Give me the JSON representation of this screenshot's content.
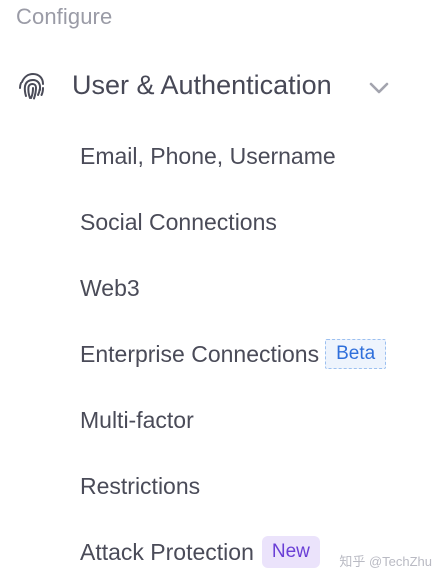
{
  "sidebar": {
    "section_title": "Configure",
    "group": {
      "label": "User & Authentication",
      "icon": "fingerprint-icon",
      "toggle_icon": "chevron-down-icon",
      "expanded": true
    },
    "items": [
      {
        "label": "Email, Phone, Username"
      },
      {
        "label": "Social Connections"
      },
      {
        "label": "Web3"
      },
      {
        "label": "Enterprise Connections",
        "badge": "Beta"
      },
      {
        "label": "Multi-factor"
      },
      {
        "label": "Restrictions"
      },
      {
        "label": "Attack Protection",
        "badge": "New"
      }
    ]
  },
  "watermark": "知乎 @TechZhu",
  "colors": {
    "section_title": "#9a9ba6",
    "text": "#4a4b58",
    "beta_badge_text": "#2f6fdb",
    "beta_badge_bg": "#eef4fd",
    "new_badge_text": "#6a3fd6",
    "new_badge_bg": "#ebe3fb"
  }
}
